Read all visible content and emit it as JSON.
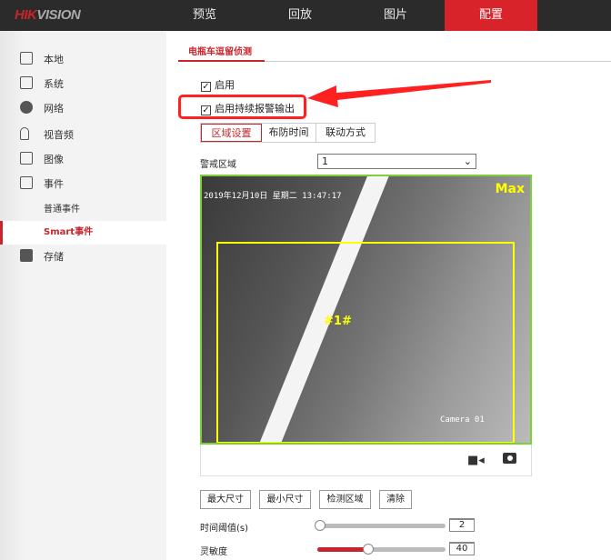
{
  "header": {
    "logo": {
      "part1": "HIK",
      "part2": "VISION"
    },
    "nav": [
      {
        "label": "预览"
      },
      {
        "label": "回放"
      },
      {
        "label": "图片"
      },
      {
        "label": "配置",
        "active": true
      }
    ]
  },
  "sidebar": {
    "items": [
      {
        "label": "本地",
        "icon": "monitor-icon"
      },
      {
        "label": "系统",
        "icon": "system-icon"
      },
      {
        "label": "网络",
        "icon": "globe-icon"
      },
      {
        "label": "视音频",
        "icon": "microphone-icon"
      },
      {
        "label": "图像",
        "icon": "image-icon"
      },
      {
        "label": "事件",
        "icon": "event-icon"
      }
    ],
    "sub_items": [
      {
        "label": "普通事件"
      },
      {
        "label": "Smart事件",
        "active": true
      }
    ],
    "storage": {
      "label": "存储",
      "icon": "storage-icon"
    }
  },
  "page": {
    "tab": "电瓶车逗留侦测",
    "enable": {
      "label": "启用",
      "checked": true
    },
    "continuous_alarm": {
      "label": "启用持续报警输出",
      "checked": true
    },
    "sub_tabs": [
      {
        "label": "区域设置",
        "active": true
      },
      {
        "label": "布防时间"
      },
      {
        "label": "联动方式"
      }
    ],
    "region": {
      "label": "警戒区域",
      "value": "1"
    },
    "video": {
      "timestamp": "2019年12月10日 星期二 13:47:17",
      "max_label": "Max",
      "region_label": "#1#",
      "camera_name": "Camera 01"
    },
    "buttons": {
      "max_size": "最大尺寸",
      "min_size": "最小尺寸",
      "detect_area": "检测区域",
      "clear": "清除"
    },
    "time_threshold": {
      "label": "时间阈值(s)",
      "value": "2",
      "fraction": 0.02
    },
    "sensitivity": {
      "label": "灵敏度",
      "value": "40",
      "fraction": 0.4
    }
  },
  "colors": {
    "accent": "#d9232a",
    "annotation": "#ff2020",
    "roi": "#ffff00",
    "video_border": "#7fcf3a"
  }
}
